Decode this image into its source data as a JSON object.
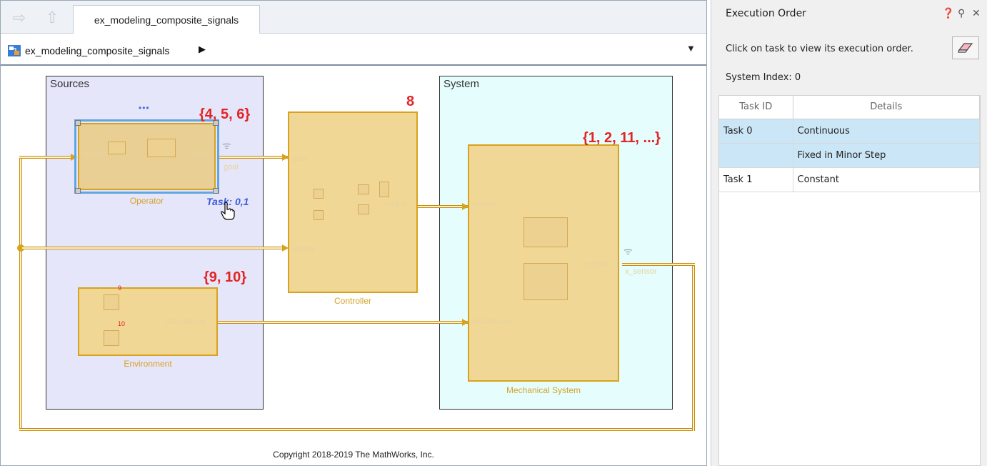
{
  "editor": {
    "tab_title": "ex_modeling_composite_signals",
    "breadcrumb": "ex_modeling_composite_signals",
    "copyright": "Copyright 2018-2019 The MathWorks, Inc."
  },
  "canvas": {
    "areas": {
      "sources": "Sources",
      "system": "System"
    },
    "blocks": {
      "operator": {
        "name": "Operator",
        "task_order": "{4, 5, 6}",
        "ports": {
          "in": "sensor",
          "out1": "goal",
          "out2": "goal"
        },
        "task_annotation": "Task: 0,1",
        "ellipsis": "•••"
      },
      "controller": {
        "name": "Controller",
        "task_order": "8",
        "ports": {
          "in1": "goal",
          "in2": "sensor",
          "out": "control"
        }
      },
      "environment": {
        "name": "Environment",
        "task_order": "{9, 10}",
        "ports": {
          "out": "disturbance"
        },
        "inner_labels": [
          "9",
          "10"
        ]
      },
      "mechanical": {
        "name": "Mechanical System",
        "task_order": "{1, 2, 11, ...}",
        "ports": {
          "in1": "control",
          "in2": "disturbance",
          "out1": "sensor",
          "out2": "x_sensor"
        }
      }
    }
  },
  "panel": {
    "title": "Execution Order",
    "instruction": "Click on task to view its execution order.",
    "system_index": "System Index: 0",
    "columns": [
      "Task ID",
      "Details"
    ],
    "rows": [
      {
        "id": "Task 0",
        "details": "Continuous",
        "selected": true
      },
      {
        "id": "",
        "details": "Fixed in Minor Step",
        "selected": true
      },
      {
        "id": "Task 1",
        "details": "Constant",
        "selected": false
      }
    ]
  },
  "colors": {
    "task_order_red": "#e32424",
    "signal": "#d9a21c",
    "sources_bg": "#e6e6fa",
    "system_bg": "#e5fdfd",
    "selection_blue": "#cbe6f7"
  }
}
